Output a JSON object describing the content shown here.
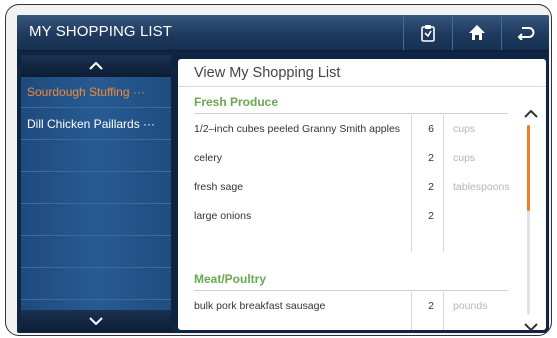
{
  "app": {
    "title": "MY SHOPPING LIST"
  },
  "toolbar": {
    "icons": [
      "shopping-list-icon",
      "home-icon",
      "back-icon"
    ]
  },
  "recipes": [
    {
      "label": "Sourdough Stuffing ···",
      "active": true
    },
    {
      "label": "Dill Chicken Paillards ···",
      "active": false
    }
  ],
  "panel": {
    "title": "View My Shopping List",
    "sections": [
      {
        "title": "Fresh Produce",
        "items": [
          {
            "name": "1/2–inch cubes peeled Granny Smith apples",
            "qty": "6",
            "unit": "cups"
          },
          {
            "name": "celery",
            "qty": "2",
            "unit": "cups"
          },
          {
            "name": "fresh sage",
            "qty": "2",
            "unit": "tablespoons"
          },
          {
            "name": "large onions",
            "qty": "2",
            "unit": ""
          }
        ]
      },
      {
        "title": "Meat/Poultry",
        "items": [
          {
            "name": "bulk pork breakfast sausage",
            "qty": "2",
            "unit": "pounds"
          }
        ]
      }
    ]
  },
  "scroll": {
    "position_fraction": 0.0,
    "visible_fraction": 0.45
  },
  "colors": {
    "active_item": "#f28b3a",
    "section_title": "#6aa84f",
    "scroll_thumb": "#f07b2c",
    "titlebar": "#1f3a5e"
  }
}
